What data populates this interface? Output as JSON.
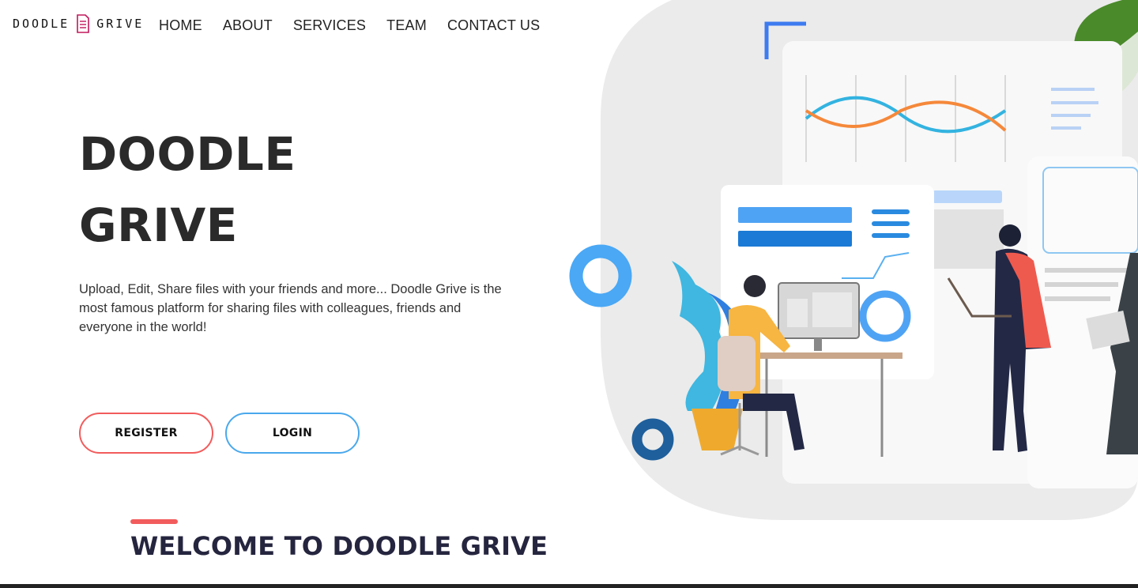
{
  "brand": {
    "name_left": "DOODLE",
    "name_right": "GRIVE",
    "accent": "#c2185b"
  },
  "nav": {
    "items": [
      {
        "label": "HOME"
      },
      {
        "label": "ABOUT"
      },
      {
        "label": "SERVICES"
      },
      {
        "label": "TEAM"
      },
      {
        "label": "CONTACT US"
      }
    ]
  },
  "hero": {
    "title_line1": "DOODLE",
    "title_line2": "GRIVE",
    "description": "Upload, Edit, Share files with your friends and more... Doodle Grive is the most famous platform for sharing files with colleagues, friends and everyone in the world!",
    "register_label": "REGISTER",
    "login_label": "LOGIN"
  },
  "welcome": {
    "title": "WELCOME TO DOODLE GRIVE"
  },
  "colors": {
    "register_border": "#f25c5c",
    "login_border": "#4aa8ec",
    "welcome_accent": "#f25c5c",
    "illustration_bg": "#ebebeb"
  }
}
